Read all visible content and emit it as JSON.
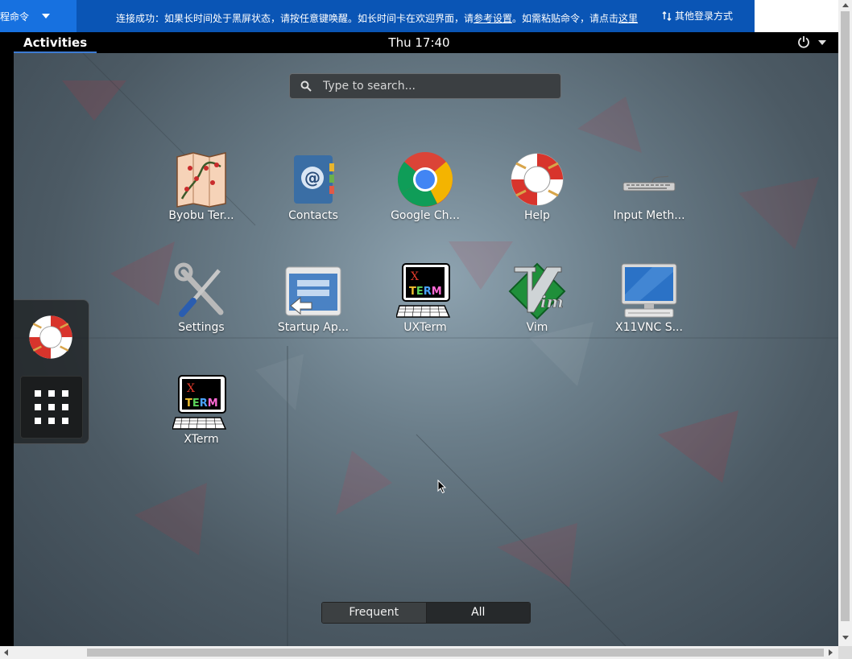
{
  "remote_bar": {
    "command_label": "程命令",
    "notice_prefix": "连接成功：如果长时间处于黑屏状态，请按任意键唤醒。如长时间卡在欢迎界面，请",
    "notice_link_settings": "参考设置",
    "notice_middle": "。如需粘贴命令，请点击",
    "notice_link_here": "这里",
    "other_login_label": "其他登录方式",
    "bar_color": "#0a55b5"
  },
  "topbar": {
    "activities_label": "Activities",
    "clock": "Thu 17:40"
  },
  "search": {
    "placeholder": "Type to search..."
  },
  "apps": [
    {
      "label": "Byobu Ter...",
      "icon": "byobu-map-icon"
    },
    {
      "label": "Contacts",
      "icon": "contacts-address-book-icon"
    },
    {
      "label": "Google Ch...",
      "icon": "chrome-icon"
    },
    {
      "label": "Help",
      "icon": "help-lifebuoy-icon"
    },
    {
      "label": "Input Meth...",
      "icon": "keyboard-icon"
    },
    {
      "label": "Settings",
      "icon": "settings-tools-icon"
    },
    {
      "label": "Startup Ap...",
      "icon": "startup-apps-icon"
    },
    {
      "label": "UXTerm",
      "icon": "xterm-icon"
    },
    {
      "label": "Vim",
      "icon": "vim-icon"
    },
    {
      "label": "X11VNC S...",
      "icon": "monitor-icon"
    },
    {
      "label": "XTerm",
      "icon": "xterm-icon"
    }
  ],
  "dash": {
    "favorites": [
      "help-lifebuoy-icon"
    ],
    "show_apps_icon": "grid-icon"
  },
  "view_switcher": {
    "frequent_label": "Frequent",
    "all_label": "All",
    "active": "All"
  }
}
